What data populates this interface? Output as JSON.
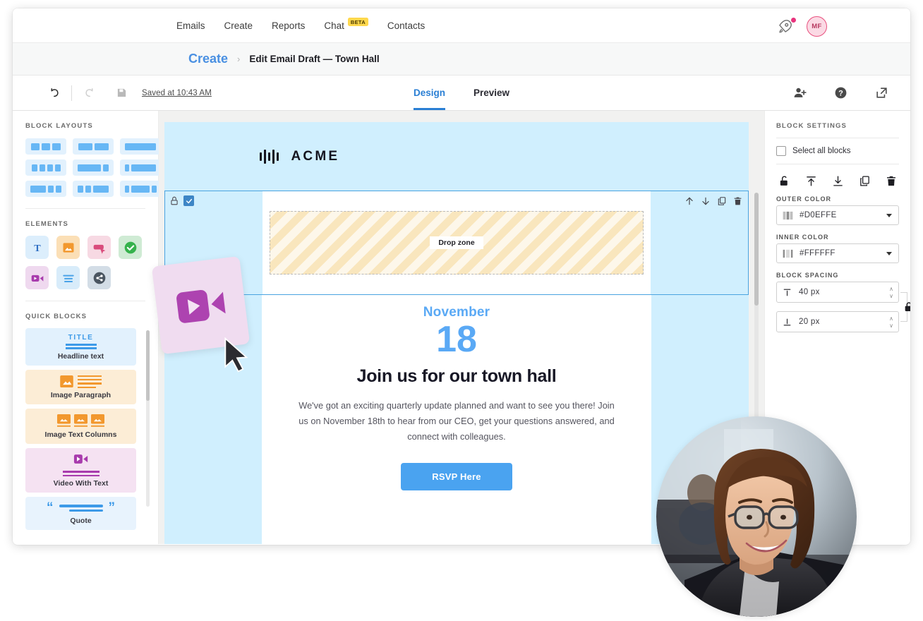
{
  "topnav": {
    "links": [
      {
        "label": "Emails",
        "badge": null
      },
      {
        "label": "Create",
        "badge": null
      },
      {
        "label": "Reports",
        "badge": null
      },
      {
        "label": "Chat",
        "badge": "BETA"
      },
      {
        "label": "Contacts",
        "badge": null
      }
    ],
    "rocket_icon": "rocket-icon",
    "notification_dot_color": "#E8337D",
    "avatar_initials": "MF"
  },
  "breadcrumb": {
    "parent": "Create",
    "separator": "›",
    "current": "Edit Email Draft — Town Hall"
  },
  "editor_toolbar": {
    "undo_icon": "undo-icon",
    "redo_icon": "redo-icon",
    "save_icon": "save-icon",
    "saved_status": "Saved at 10:43 AM",
    "tabs": [
      {
        "label": "Design",
        "active": true
      },
      {
        "label": "Preview",
        "active": false
      }
    ],
    "right_icons": [
      "add-user-icon",
      "help-icon",
      "share-export-icon"
    ]
  },
  "left_panel": {
    "block_layouts_title": "BLOCK LAYOUTS",
    "layouts": [
      {
        "name": "three-equal-columns",
        "bars": [
          12,
          12,
          12
        ]
      },
      {
        "name": "two-equal-columns",
        "bars": [
          20,
          20
        ]
      },
      {
        "name": "one-full-column",
        "bars": [
          44
        ]
      },
      {
        "name": "four-equal-columns",
        "bars": [
          8,
          8,
          8,
          8
        ]
      },
      {
        "name": "wide-left-narrow-right",
        "bars": [
          33,
          8
        ]
      },
      {
        "name": "narrow-left-wide-right",
        "bars": [
          6,
          35
        ]
      },
      {
        "name": "wide-left-two-narrow",
        "bars": [
          22,
          8,
          8
        ]
      },
      {
        "name": "two-narrow-wide-right",
        "bars": [
          8,
          8,
          22
        ]
      },
      {
        "name": "narrow-wide-narrow",
        "bars": [
          6,
          26,
          7
        ]
      }
    ],
    "elements_title": "ELEMENTS",
    "elements": [
      {
        "name": "text-element",
        "icon": "text-T-icon",
        "bg": "#DCEEFC",
        "fg": "#2F6FC4"
      },
      {
        "name": "image-element",
        "icon": "image-icon",
        "bg": "#FBDFB6",
        "fg": "#F2982E"
      },
      {
        "name": "button-element",
        "icon": "button-click-icon",
        "bg": "#F7D9E3",
        "fg": "#D94C7C"
      },
      {
        "name": "survey-element",
        "icon": "check-circle-icon",
        "bg": "#CFEBD4",
        "fg": "#35B24C"
      },
      {
        "name": "video-element",
        "icon": "video-camera-icon",
        "bg": "#EFD9EF",
        "fg": "#A83BAD"
      },
      {
        "name": "paragraph-element",
        "icon": "text-lines-icon",
        "bg": "#D8ECFA",
        "fg": "#4AA3E8"
      },
      {
        "name": "social-share-element",
        "icon": "share-nodes-icon",
        "bg": "#D3DDE6",
        "fg": "#4A5560"
      }
    ],
    "quick_blocks_title": "QUICK BLOCKS",
    "quick_blocks": [
      {
        "label": "Headline text",
        "icon": "title-underline-icon",
        "bg": "#E2F1FD",
        "fg": "#3D9AE8",
        "word": "TITLE"
      },
      {
        "label": "Image Paragraph",
        "icon": "image-with-lines-icon",
        "bg": "#FCEDD6",
        "fg": "#F2982E"
      },
      {
        "label": "Image Text Columns",
        "icon": "three-images-icon",
        "bg": "#FCEDD6",
        "fg": "#F2982E"
      },
      {
        "label": "Video With Text",
        "icon": "video-with-lines-icon",
        "bg": "#F5E2F2",
        "fg": "#A83BAD"
      },
      {
        "label": "Quote",
        "icon": "quote-marks-icon",
        "bg": "#E8F3FD",
        "fg": "#3D9AE8"
      }
    ]
  },
  "canvas": {
    "logo_word": "ACME",
    "logo_icon": "acme-bars-logo",
    "block_toolbar": {
      "lock_icon": "lock-icon",
      "select_checkbox_checked": true,
      "move_up_icon": "arrow-up-icon",
      "move_down_icon": "arrow-down-icon",
      "duplicate_icon": "duplicate-icon",
      "delete_icon": "trash-icon"
    },
    "dropzone_label": "Drop zone",
    "email": {
      "month": "November",
      "day": "18",
      "headline": "Join us for our town hall",
      "body": "We've got an exciting quarterly update planned and want to see you there! Join us on November 18th to hear from our CEO, get your questions answered, and connect with colleagues.",
      "cta_label": "RSVP Here"
    }
  },
  "right_panel": {
    "title": "BLOCK SETTINGS",
    "select_all_label": "Select all blocks",
    "select_all_checked": false,
    "action_icons": [
      "unlock-icon",
      "align-top-icon",
      "align-bottom-icon",
      "duplicate-icon",
      "trash-icon"
    ],
    "outer_color_label": "OUTER COLOR",
    "outer_color_value": "#D0EFFE",
    "inner_color_label": "INNER COLOR",
    "inner_color_value": "#FFFFFF",
    "block_spacing_label": "BLOCK SPACING",
    "spacing_top_value": "40 px",
    "spacing_bottom_value": "20 px",
    "spacing_lock_icon": "lock-closed-icon"
  },
  "drag": {
    "card_icon": "video-camera-icon",
    "cursor_icon": "cursor-arrow-icon"
  }
}
